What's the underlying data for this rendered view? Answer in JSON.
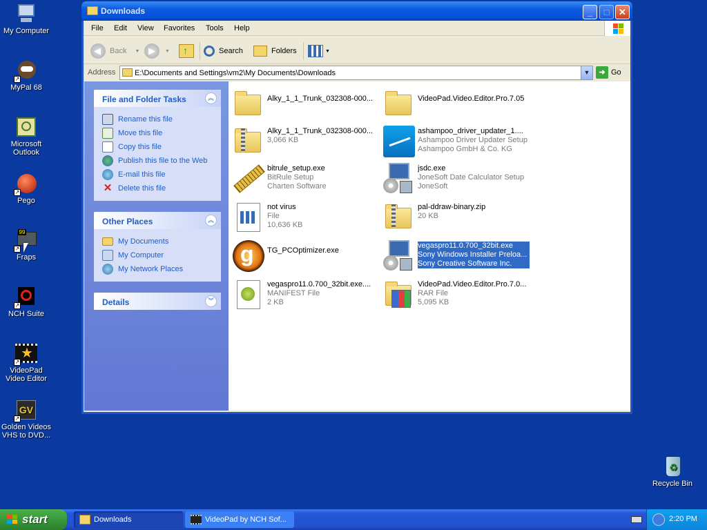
{
  "desktop": {
    "icons": [
      {
        "label": "My Computer",
        "icon": "my-computer-icon"
      },
      {
        "label": "MyPal 68",
        "icon": "mypal-icon"
      },
      {
        "label": "Microsoft Outlook",
        "icon": "outlook-icon"
      },
      {
        "label": "Pego",
        "icon": "pego-icon"
      },
      {
        "label": "Fraps",
        "icon": "fraps-icon"
      },
      {
        "label": "NCH Suite",
        "icon": "nch-suite-icon"
      },
      {
        "label": "VideoPad Video Editor",
        "icon": "videopad-icon"
      },
      {
        "label": "Golden Videos VHS to DVD...",
        "icon": "golden-videos-icon"
      },
      {
        "label": "Recycle Bin",
        "icon": "recycle-bin-icon"
      }
    ]
  },
  "window": {
    "title": "Downloads",
    "menu": [
      "File",
      "Edit",
      "View",
      "Favorites",
      "Tools",
      "Help"
    ],
    "toolbar": {
      "back": "Back",
      "search": "Search",
      "folders": "Folders"
    },
    "address": {
      "label": "Address",
      "value": "E:\\Documents and Settings\\vm2\\My Documents\\Downloads",
      "go": "Go"
    },
    "taskpane": {
      "file_tasks": {
        "title": "File and Folder Tasks",
        "items": [
          "Rename this file",
          "Move this file",
          "Copy this file",
          "Publish this file to the Web",
          "E-mail this file",
          "Delete this file"
        ]
      },
      "other_places": {
        "title": "Other Places",
        "items": [
          "My Documents",
          "My Computer",
          "My Network Places"
        ]
      },
      "details": {
        "title": "Details"
      }
    },
    "files": [
      {
        "name": "Alky_1_1_Trunk_032308-000...",
        "line2": "",
        "line3": "",
        "icon": "folder-icon"
      },
      {
        "name": "VideoPad.Video.Editor.Pro.7.05",
        "line2": "",
        "line3": "",
        "icon": "folder-icon"
      },
      {
        "name": "Alky_1_1_Trunk_032308-000...",
        "line2": "3,066 KB",
        "line3": "",
        "icon": "zip-folder-icon"
      },
      {
        "name": "ashampoo_driver_updater_1....",
        "line2": "Ashampoo Driver Updater Setup",
        "line3": "Ashampoo GmbH & Co. KG",
        "icon": "ashampoo-icon"
      },
      {
        "name": "bitrule_setup.exe",
        "line2": "BitRule Setup",
        "line3": "Charten Software",
        "icon": "ruler-icon"
      },
      {
        "name": "jsdc.exe",
        "line2": "JoneSoft Date Calculator Setup",
        "line3": "JoneSoft",
        "icon": "installer-icon"
      },
      {
        "name": "not virus",
        "line2": "File",
        "line3": "10,636 KB",
        "icon": "generic-file-icon"
      },
      {
        "name": "pal-ddraw-binary.zip",
        "line2": "20 KB",
        "line3": "",
        "icon": "zip-folder-icon"
      },
      {
        "name": "TG_PCOptimizer.exe",
        "line2": "",
        "line3": "",
        "icon": "pc-optimizer-icon"
      },
      {
        "name": "vegaspro11.0.700_32bit.exe",
        "line2": "Sony Windows Installer Preloa...",
        "line3": "Sony Creative Software Inc.",
        "icon": "installer-icon",
        "selected": true
      },
      {
        "name": "vegaspro11.0.700_32bit.exe....",
        "line2": "MANIFEST File",
        "line3": "2 KB",
        "icon": "manifest-file-icon"
      },
      {
        "name": "VideoPad.Video.Editor.Pro.7.0...",
        "line2": "RAR File",
        "line3": "5,095 KB",
        "icon": "rar-file-icon"
      }
    ]
  },
  "taskbar": {
    "start": "start",
    "tasks": [
      "Downloads",
      "VideoPad by NCH Sof..."
    ],
    "clock": "2:20 PM"
  }
}
